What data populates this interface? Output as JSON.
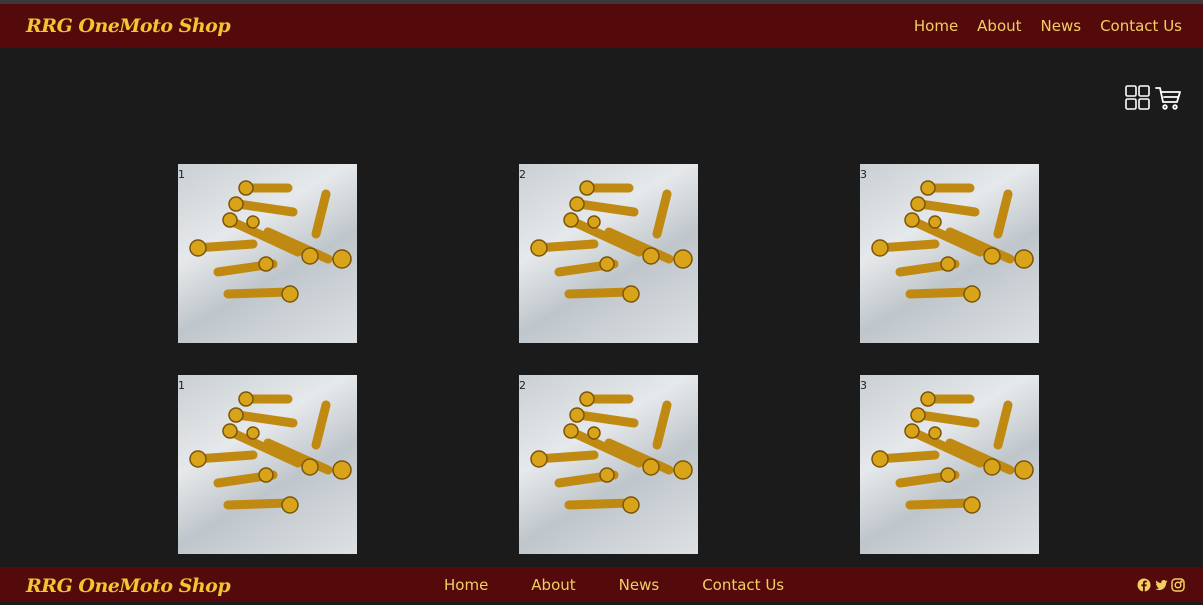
{
  "header": {
    "brand": "RRG OneMoto Shop",
    "nav": [
      "Home",
      "About",
      "News",
      "Contact Us"
    ]
  },
  "toolbar": {
    "icons": [
      "grid-view-icon",
      "cart-icon"
    ]
  },
  "products": [
    {
      "label": "1"
    },
    {
      "label": "2"
    },
    {
      "label": "3"
    },
    {
      "label": "1"
    },
    {
      "label": "2"
    },
    {
      "label": "3"
    }
  ],
  "footer": {
    "brand": "RRG OneMoto Shop",
    "nav": [
      "Home",
      "About",
      "News",
      "Contact Us"
    ],
    "social": [
      "facebook-icon",
      "twitter-icon",
      "instagram-icon"
    ]
  },
  "colors": {
    "header_bg": "#540a0a",
    "page_bg": "#1b1b1b",
    "brand": "#f2c531",
    "nav_text": "#f3cf63"
  }
}
